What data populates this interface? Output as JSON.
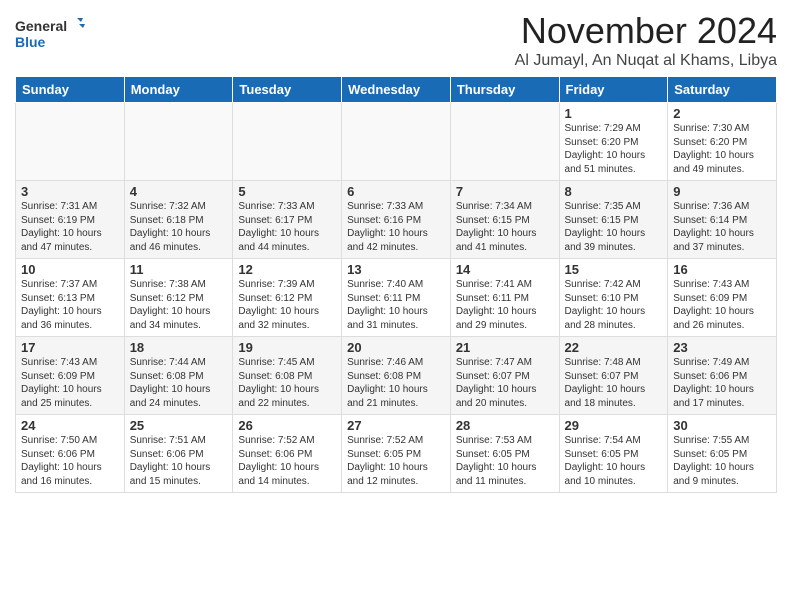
{
  "logo": {
    "line1": "General",
    "line2": "Blue"
  },
  "title": "November 2024",
  "location": "Al Jumayl, An Nuqat al Khams, Libya",
  "days_of_week": [
    "Sunday",
    "Monday",
    "Tuesday",
    "Wednesday",
    "Thursday",
    "Friday",
    "Saturday"
  ],
  "weeks": [
    [
      {
        "day": "",
        "info": ""
      },
      {
        "day": "",
        "info": ""
      },
      {
        "day": "",
        "info": ""
      },
      {
        "day": "",
        "info": ""
      },
      {
        "day": "",
        "info": ""
      },
      {
        "day": "1",
        "info": "Sunrise: 7:29 AM\nSunset: 6:20 PM\nDaylight: 10 hours and 51 minutes."
      },
      {
        "day": "2",
        "info": "Sunrise: 7:30 AM\nSunset: 6:20 PM\nDaylight: 10 hours and 49 minutes."
      }
    ],
    [
      {
        "day": "3",
        "info": "Sunrise: 7:31 AM\nSunset: 6:19 PM\nDaylight: 10 hours and 47 minutes."
      },
      {
        "day": "4",
        "info": "Sunrise: 7:32 AM\nSunset: 6:18 PM\nDaylight: 10 hours and 46 minutes."
      },
      {
        "day": "5",
        "info": "Sunrise: 7:33 AM\nSunset: 6:17 PM\nDaylight: 10 hours and 44 minutes."
      },
      {
        "day": "6",
        "info": "Sunrise: 7:33 AM\nSunset: 6:16 PM\nDaylight: 10 hours and 42 minutes."
      },
      {
        "day": "7",
        "info": "Sunrise: 7:34 AM\nSunset: 6:15 PM\nDaylight: 10 hours and 41 minutes."
      },
      {
        "day": "8",
        "info": "Sunrise: 7:35 AM\nSunset: 6:15 PM\nDaylight: 10 hours and 39 minutes."
      },
      {
        "day": "9",
        "info": "Sunrise: 7:36 AM\nSunset: 6:14 PM\nDaylight: 10 hours and 37 minutes."
      }
    ],
    [
      {
        "day": "10",
        "info": "Sunrise: 7:37 AM\nSunset: 6:13 PM\nDaylight: 10 hours and 36 minutes."
      },
      {
        "day": "11",
        "info": "Sunrise: 7:38 AM\nSunset: 6:12 PM\nDaylight: 10 hours and 34 minutes."
      },
      {
        "day": "12",
        "info": "Sunrise: 7:39 AM\nSunset: 6:12 PM\nDaylight: 10 hours and 32 minutes."
      },
      {
        "day": "13",
        "info": "Sunrise: 7:40 AM\nSunset: 6:11 PM\nDaylight: 10 hours and 31 minutes."
      },
      {
        "day": "14",
        "info": "Sunrise: 7:41 AM\nSunset: 6:11 PM\nDaylight: 10 hours and 29 minutes."
      },
      {
        "day": "15",
        "info": "Sunrise: 7:42 AM\nSunset: 6:10 PM\nDaylight: 10 hours and 28 minutes."
      },
      {
        "day": "16",
        "info": "Sunrise: 7:43 AM\nSunset: 6:09 PM\nDaylight: 10 hours and 26 minutes."
      }
    ],
    [
      {
        "day": "17",
        "info": "Sunrise: 7:43 AM\nSunset: 6:09 PM\nDaylight: 10 hours and 25 minutes."
      },
      {
        "day": "18",
        "info": "Sunrise: 7:44 AM\nSunset: 6:08 PM\nDaylight: 10 hours and 24 minutes."
      },
      {
        "day": "19",
        "info": "Sunrise: 7:45 AM\nSunset: 6:08 PM\nDaylight: 10 hours and 22 minutes."
      },
      {
        "day": "20",
        "info": "Sunrise: 7:46 AM\nSunset: 6:08 PM\nDaylight: 10 hours and 21 minutes."
      },
      {
        "day": "21",
        "info": "Sunrise: 7:47 AM\nSunset: 6:07 PM\nDaylight: 10 hours and 20 minutes."
      },
      {
        "day": "22",
        "info": "Sunrise: 7:48 AM\nSunset: 6:07 PM\nDaylight: 10 hours and 18 minutes."
      },
      {
        "day": "23",
        "info": "Sunrise: 7:49 AM\nSunset: 6:06 PM\nDaylight: 10 hours and 17 minutes."
      }
    ],
    [
      {
        "day": "24",
        "info": "Sunrise: 7:50 AM\nSunset: 6:06 PM\nDaylight: 10 hours and 16 minutes."
      },
      {
        "day": "25",
        "info": "Sunrise: 7:51 AM\nSunset: 6:06 PM\nDaylight: 10 hours and 15 minutes."
      },
      {
        "day": "26",
        "info": "Sunrise: 7:52 AM\nSunset: 6:06 PM\nDaylight: 10 hours and 14 minutes."
      },
      {
        "day": "27",
        "info": "Sunrise: 7:52 AM\nSunset: 6:05 PM\nDaylight: 10 hours and 12 minutes."
      },
      {
        "day": "28",
        "info": "Sunrise: 7:53 AM\nSunset: 6:05 PM\nDaylight: 10 hours and 11 minutes."
      },
      {
        "day": "29",
        "info": "Sunrise: 7:54 AM\nSunset: 6:05 PM\nDaylight: 10 hours and 10 minutes."
      },
      {
        "day": "30",
        "info": "Sunrise: 7:55 AM\nSunset: 6:05 PM\nDaylight: 10 hours and 9 minutes."
      }
    ]
  ]
}
